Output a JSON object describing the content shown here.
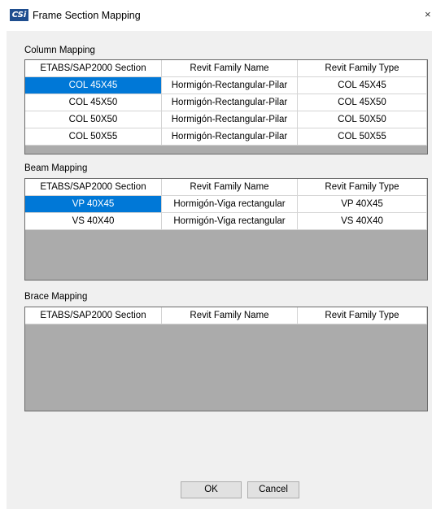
{
  "window": {
    "title": "Frame Section Mapping",
    "icon_text": "CSi",
    "close_glyph": "×"
  },
  "column_mapping": {
    "label": "Column Mapping",
    "headers": [
      "ETABS/SAP2000 Section",
      "Revit Family Name",
      "Revit Family Type"
    ],
    "rows": [
      [
        "COL 45X45",
        "Hormigón-Rectangular-Pilar",
        "COL 45X45"
      ],
      [
        "COL 45X50",
        "Hormigón-Rectangular-Pilar",
        "COL 45X50"
      ],
      [
        "COL 50X50",
        "Hormigón-Rectangular-Pilar",
        "COL 50X50"
      ],
      [
        "COL 50X55",
        "Hormigón-Rectangular-Pilar",
        "COL 50X55"
      ]
    ]
  },
  "beam_mapping": {
    "label": "Beam Mapping",
    "headers": [
      "ETABS/SAP2000 Section",
      "Revit Family Name",
      "Revit Family Type"
    ],
    "rows": [
      [
        "VP 40X45",
        "Hormigón-Viga rectangular",
        "VP 40X45"
      ],
      [
        "VS 40X40",
        "Hormigón-Viga rectangular",
        "VS 40X40"
      ]
    ]
  },
  "brace_mapping": {
    "label": "Brace Mapping",
    "headers": [
      "ETABS/SAP2000 Section",
      "Revit Family Name",
      "Revit Family Type"
    ]
  },
  "buttons": {
    "ok": "OK",
    "cancel": "Cancel"
  },
  "colors": {
    "selection": "#0078d7",
    "grid_empty_area": "#ababab",
    "dialog_background": "#f0f0f0"
  }
}
